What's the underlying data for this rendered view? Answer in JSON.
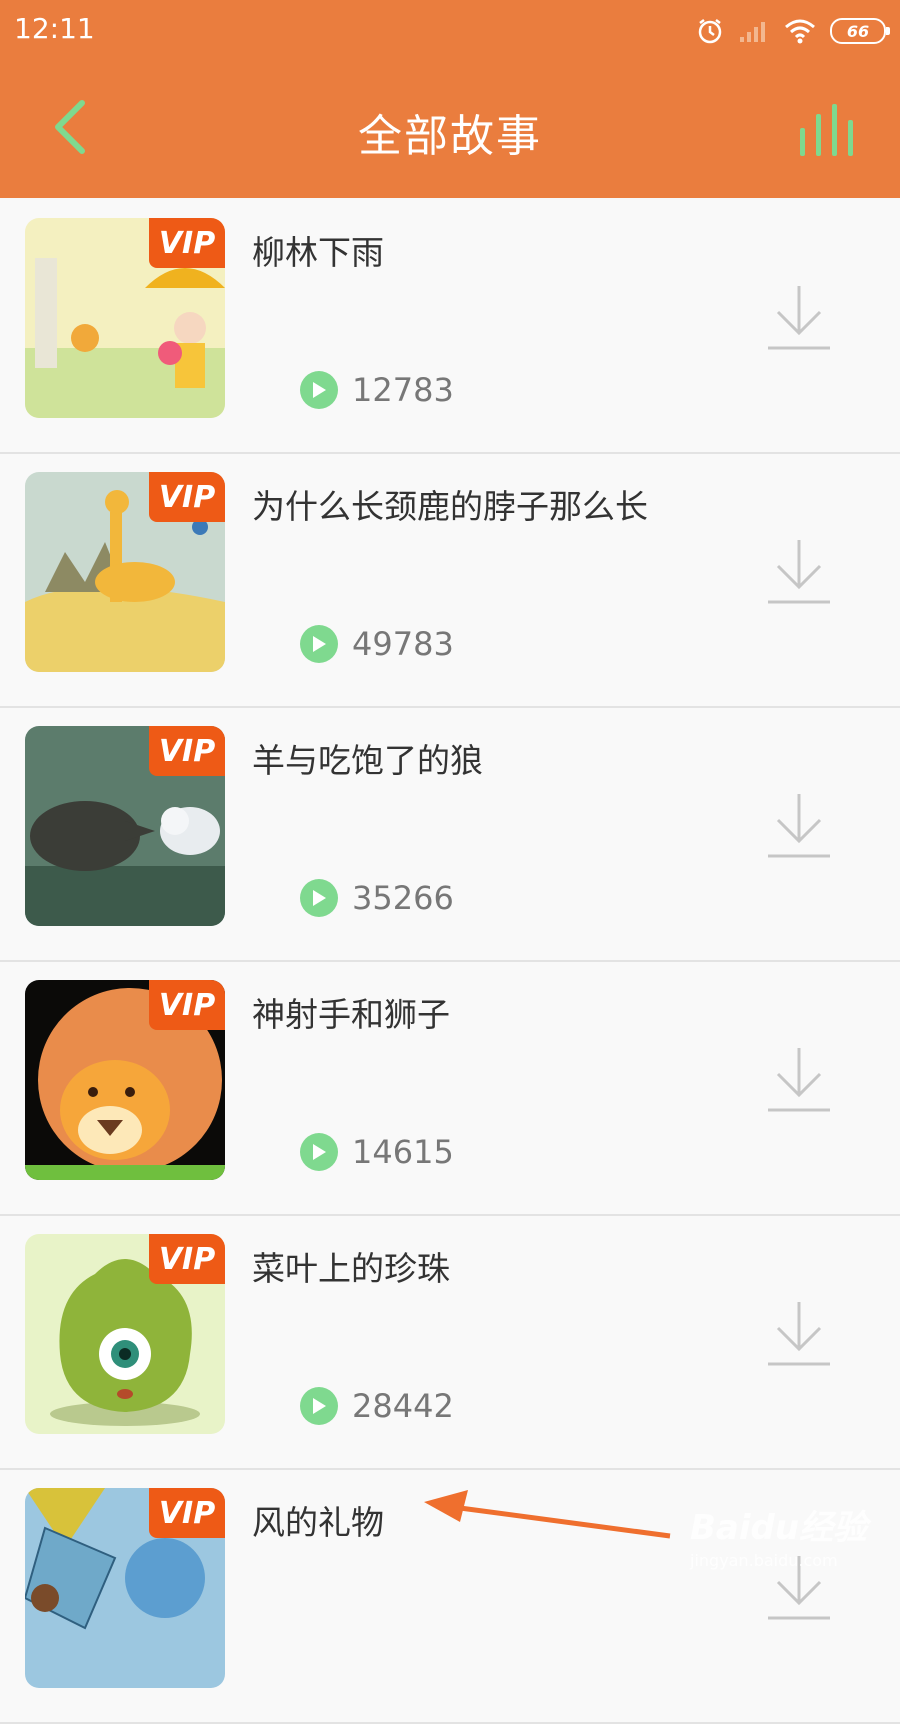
{
  "status_bar": {
    "time": "12:11",
    "battery": "66"
  },
  "header": {
    "title": "全部故事"
  },
  "stories": [
    {
      "title": "柳林下雨",
      "plays": "12783",
      "vip": "VIP"
    },
    {
      "title": "为什么长颈鹿的脖子那么长",
      "plays": "49783",
      "vip": "VIP"
    },
    {
      "title": "羊与吃饱了的狼",
      "plays": "35266",
      "vip": "VIP"
    },
    {
      "title": "神射手和狮子",
      "plays": "14615",
      "vip": "VIP"
    },
    {
      "title": "菜叶上的珍珠",
      "plays": "28442",
      "vip": "VIP"
    },
    {
      "title": "风的礼物",
      "plays": "",
      "vip": "VIP"
    }
  ],
  "watermark": {
    "brand": "Baidu经验",
    "url": "jingyan.baidu.com"
  },
  "colors": {
    "header": "#ea7d3e",
    "accent_green": "#7fd98f",
    "vip_badge": "#ee5a16"
  }
}
